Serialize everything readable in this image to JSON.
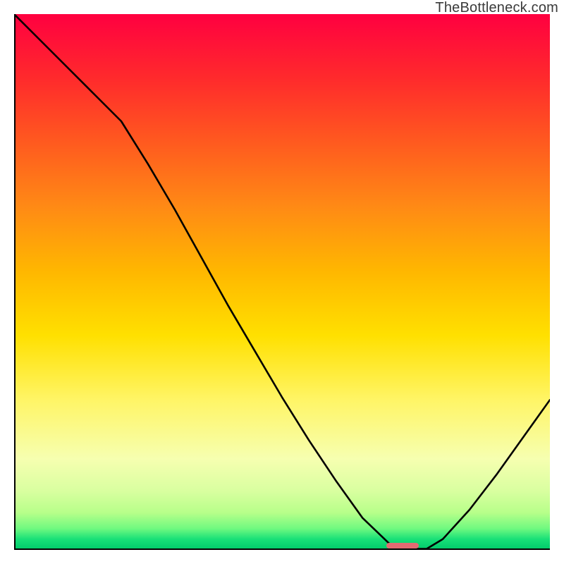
{
  "watermark": "TheBottleneck.com",
  "annotation": {
    "x_frac": 0.725,
    "width_frac": 0.06,
    "color": "#e36a72"
  },
  "chart_data": {
    "type": "line",
    "title": "",
    "xlabel": "",
    "ylabel": "",
    "xlim": [
      0,
      1
    ],
    "ylim": [
      0,
      1
    ],
    "background_gradient": {
      "top": "#ff0040",
      "bottom": "#00c96a",
      "meaning": "red=high bottleneck, green=low bottleneck"
    },
    "series": [
      {
        "name": "bottleneck-curve",
        "x": [
          0.0,
          0.05,
          0.1,
          0.15,
          0.2,
          0.25,
          0.3,
          0.35,
          0.4,
          0.45,
          0.5,
          0.55,
          0.6,
          0.65,
          0.7,
          0.73,
          0.77,
          0.8,
          0.85,
          0.9,
          0.95,
          1.0
        ],
        "y": [
          1.0,
          0.95,
          0.9,
          0.85,
          0.8,
          0.72,
          0.635,
          0.545,
          0.455,
          0.37,
          0.285,
          0.205,
          0.13,
          0.06,
          0.012,
          0.002,
          0.002,
          0.02,
          0.075,
          0.14,
          0.21,
          0.28
        ]
      }
    ],
    "annotation_region": {
      "name": "optimal-range-pill",
      "x_start": 0.695,
      "x_end": 0.755,
      "color": "#e36a72"
    }
  }
}
